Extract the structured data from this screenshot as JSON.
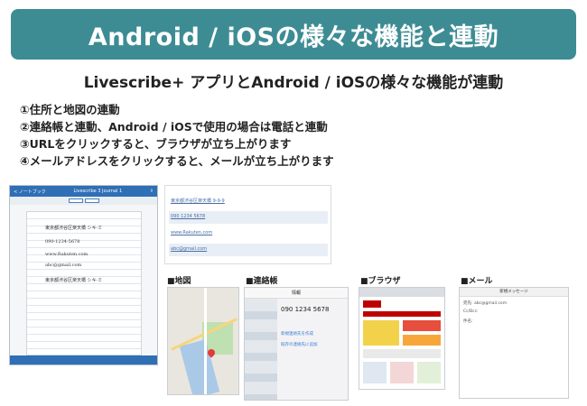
{
  "banner": {
    "title": "Android / iOSの様々な機能と連動"
  },
  "subtitle": "Livescribe+ アプリとAndroid / iOSの様々な機能が連動",
  "features": [
    "①住所と地図の連動",
    "②連絡帳と連動、Android / iOSで使用の場合は電話と連動",
    "③URLをクリックすると、ブラウザが立ち上がります",
    "④メールアドレスをクリックすると、メールが立ち上がります"
  ],
  "tablet": {
    "back_label": "< ノートブック",
    "title": "Livescribe 3 Journal 1",
    "notes": [
      "東京都渋谷区楽天橋 シキ-ミ",
      "090-1234-5678",
      "www.Rakuten.com",
      "abc@gmail.com",
      "東京都渋谷区楽天橋 シキ-ミ"
    ]
  },
  "doc": {
    "rows": [
      "東京都渋谷区楽天橋 9-9-9",
      "090 1234 5678",
      "www.Rakuten.com",
      "abc@gmail.com"
    ]
  },
  "labels": {
    "map": "■地図",
    "contacts": "■連絡帳",
    "browser": "■ブラウザ",
    "mail": "■メール"
  },
  "contacts": {
    "header": "情報",
    "phone": "090 1234 5678",
    "create": "新規連絡先を作成",
    "add": "既存の連絡先に追加"
  },
  "mail": {
    "header": "新規メッセージ",
    "to": "宛先: abc@gmail.com",
    "cc": "Cc/Bcc:",
    "subject": "件名:"
  },
  "colors": {
    "banner": "#3d8c94",
    "tablet_bar": "#2f6fb5",
    "link": "#4a6fa5"
  }
}
